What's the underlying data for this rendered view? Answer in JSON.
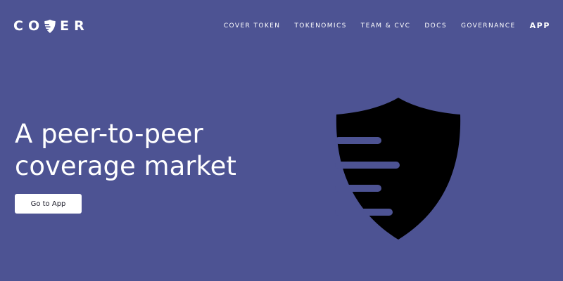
{
  "brand": {
    "logo_left": "CO",
    "logo_right": "ER",
    "logo_icon": "shield-icon"
  },
  "nav": {
    "items": [
      {
        "label": "COVER TOKEN"
      },
      {
        "label": "TOKENOMICS"
      },
      {
        "label": "TEAM & CVC"
      },
      {
        "label": "DOCS"
      },
      {
        "label": "GOVERNANCE"
      }
    ],
    "app_label": "APP"
  },
  "hero": {
    "title_line1": "A peer-to-peer",
    "title_line2": "coverage market",
    "cta_label": "Go to App",
    "illustration_icon": "shield-icon"
  },
  "colors": {
    "background": "#4d5393",
    "text": "#ffffff",
    "shield": "#000000",
    "button_bg": "#ffffff",
    "button_text": "#1d1d2b"
  }
}
